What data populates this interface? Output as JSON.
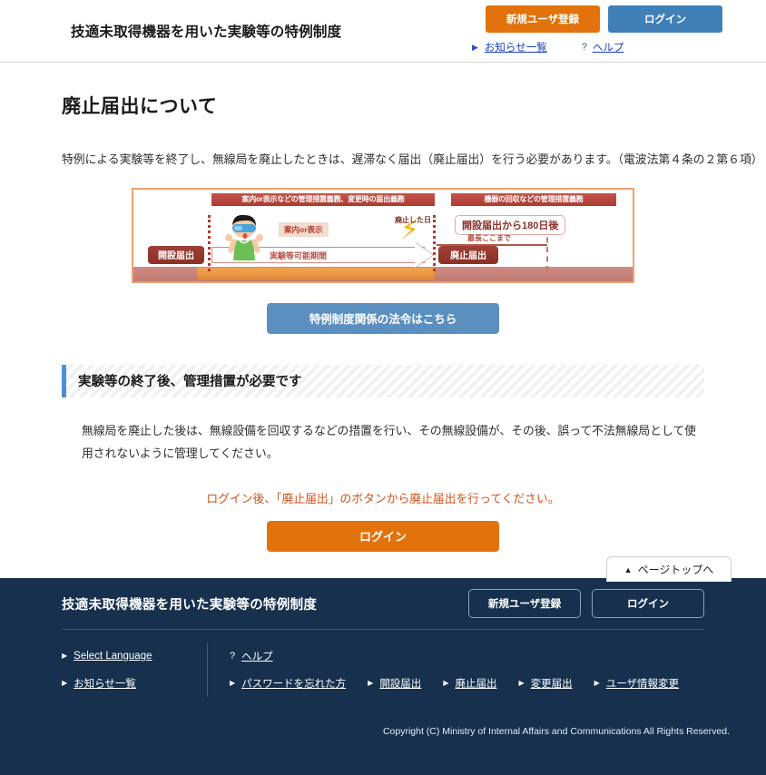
{
  "header": {
    "title": "技適未取得機器を用いた実験等の特例制度",
    "register_button": "新規ユーザ登録",
    "login_button": "ログイン",
    "links": [
      {
        "icon": "triangle-right-icon",
        "label": "お知らせ一覧"
      },
      {
        "icon": "question-mark-icon",
        "label": "ヘルプ"
      }
    ]
  },
  "main": {
    "page_title": "廃止届出について",
    "lead_text": "特例による実験等を終了し、無線局を廃止したときは、遅滞なく届出（廃止届出）を行う必要があります。（電波法第４条の２第６項）",
    "diagram": {
      "band_left": "案内or表示などの管理措置義務、変更時の届出義務",
      "band_right": "機器の回収などの管理措置義務",
      "chip_open": "開設届出",
      "chip_close": "廃止届出",
      "arrow_label": "実験等可能期間",
      "callout": "案内or表示",
      "note_date": "廃止した日",
      "note_max": "最長ここまで",
      "box_180": "開設届出から180日後"
    },
    "law_button": "特例制度関係の法令はこちら",
    "section_heading": "実験等の終了後、管理措置が必要です",
    "section_body": "無線局を廃止した後は、無線設備を回収するなどの措置を行い、その無線設備が、その後、誤って不法無線局として使用されないように管理してください。",
    "notice": "ログイン後、「廃止届出」のボタンから廃止届出を行ってください。",
    "login_button": "ログイン"
  },
  "pagetop": {
    "label": "ページトップへ",
    "icon": "triangle-up-icon"
  },
  "footer": {
    "title": "技適未取得機器を用いた実験等の特例制度",
    "register_button": "新規ユーザ登録",
    "login_button": "ログイン",
    "left_links": [
      {
        "icon": "triangle-right-icon",
        "label": "Select Language"
      },
      {
        "icon": "triangle-right-icon",
        "label": "お知らせ一覧"
      }
    ],
    "right_row_1": [
      {
        "icon": "question-mark-icon",
        "label": "ヘルプ"
      }
    ],
    "right_row_2": [
      {
        "icon": "triangle-right-icon",
        "label": "パスワードを忘れた方"
      },
      {
        "icon": "triangle-right-icon",
        "label": "開設届出"
      },
      {
        "icon": "triangle-right-icon",
        "label": "廃止届出"
      },
      {
        "icon": "triangle-right-icon",
        "label": "変更届出"
      },
      {
        "icon": "triangle-right-icon",
        "label": "ユーザ情報変更"
      }
    ],
    "copyright": "Copyright (C) Ministry of Internal Affairs and Communications All Rights Reserved."
  },
  "colors": {
    "orange": "#e2730c",
    "blue": "#4080b8",
    "law_blue": "#5b8fc0",
    "footer_navy": "#16304d",
    "notice_orange": "#d0521b",
    "link_blue": "#1b3fbb"
  }
}
